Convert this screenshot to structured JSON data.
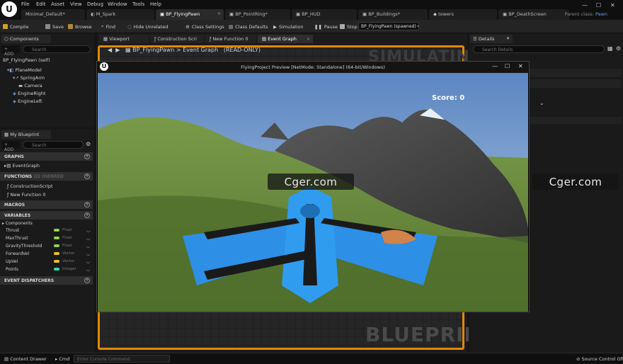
{
  "menu": [
    "File",
    "Edit",
    "Asset",
    "View",
    "Debug",
    "Window",
    "Tools",
    "Help"
  ],
  "doc_tabs": [
    "Minimal_Default*",
    "M_Spark",
    "BP_FlyingPawn",
    "BP_PointRing*",
    "BP_HUD",
    "BP_Buildings*",
    "towers",
    "BP_DeathScreen"
  ],
  "parent_class_label": "Parent class:",
  "parent_class_value": "Pawn",
  "toolbar": {
    "compile": "Compile",
    "save": "Save",
    "browse": "Browse",
    "find": "Find",
    "hide_unrelated": "Hide Unrelated",
    "class_settings": "Class Settings",
    "class_defaults": "Class Defaults",
    "simulation": "Simulation",
    "pause": "Pause",
    "stop": "Stop",
    "debug_object": "BP_FlyingPawn (spawned)"
  },
  "components_panel": {
    "tab": "Components",
    "add": "+ ADD",
    "search_placeholder": "Search",
    "root": "BP_FlyingPawn (self)",
    "items": [
      "PlaneModel",
      "SpringArm",
      "Camera",
      "EngineRight",
      "EngineLeft"
    ]
  },
  "my_blueprint": {
    "tab": "My Blueprint",
    "add": "+ ADD",
    "search_placeholder": "Search",
    "graphs_header": "GRAPHS",
    "graphs": [
      "EventGraph"
    ],
    "functions_header": "FUNCTIONS",
    "functions_sub": "(22 OVERRIDE",
    "functions": [
      "ConstructionScript",
      "New Function 0"
    ],
    "macros_header": "MACROS",
    "variables_header": "VARIABLES",
    "components_label": "Components",
    "variables": [
      {
        "name": "Thrust",
        "type": "Float"
      },
      {
        "name": "MaxThrust",
        "type": "Float"
      },
      {
        "name": "GravityThreshold",
        "type": "Float"
      },
      {
        "name": "ForwardVel",
        "type": "Vector"
      },
      {
        "name": "UpVel",
        "type": "Vector"
      },
      {
        "name": "Points",
        "type": "Integer"
      }
    ],
    "dispatchers_header": "EVENT DISPATCHERS"
  },
  "graph_tabs": [
    "Viewport",
    "Construction Scri",
    "New Function 0",
    "Event Graph"
  ],
  "breadcrumb": {
    "pawn": "BP_FlyingPawn",
    "graph": "Event Graph",
    "mode": "(READ-ONLY)"
  },
  "graph_overlay": {
    "simulating": "SIMULATING",
    "blueprint": "BLUEPRINT"
  },
  "details": {
    "tab": "Details",
    "search_placeholder": "Search Details"
  },
  "preview": {
    "title": "FlyingProject Preview [NetMode: Standalone]  (64-bit/Windows)",
    "score": "Score: 0"
  },
  "watermarks": [
    "Cger.com",
    "Cger.com"
  ],
  "bottom": {
    "content_drawer": "Content Drawer",
    "cmd": "Cmd",
    "cmd_placeholder": "Enter Console Command",
    "source_control": "Source Control Off"
  },
  "colors": {
    "accent_orange": "#e08a00",
    "float_pin": "#8ed44a",
    "vector_pin": "#f2c21b",
    "integer_pin": "#2ee0b0",
    "plane_blue": "#2d8fe6"
  }
}
